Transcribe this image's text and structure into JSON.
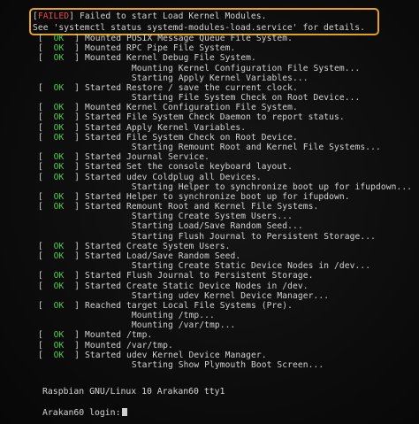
{
  "failed_notice": {
    "tag_open": "[",
    "tag_text": "FAILED",
    "tag_close": "]",
    "line1": "Failed to start Load Kernel Modules.",
    "line2": "See 'systemctl status systemd-modules-load.service' for details."
  },
  "log": [
    {
      "status": "OK",
      "text": "Mounted POSIX Message Queue File System."
    },
    {
      "status": "OK",
      "text": "Mounted RPC Pipe File System."
    },
    {
      "status": "OK",
      "text": "Mounted Kernel Debug File System."
    },
    {
      "status": "",
      "text": "Mounting Kernel Configuration File System..."
    },
    {
      "status": "",
      "text": "Starting Apply Kernel Variables..."
    },
    {
      "status": "OK",
      "text": "Started Restore / save the current clock."
    },
    {
      "status": "",
      "text": "Starting File System Check on Root Device..."
    },
    {
      "status": "OK",
      "text": "Mounted Kernel Configuration File System."
    },
    {
      "status": "OK",
      "text": "Started File System Check Daemon to report status."
    },
    {
      "status": "OK",
      "text": "Started Apply Kernel Variables."
    },
    {
      "status": "OK",
      "text": "Started File System Check on Root Device."
    },
    {
      "status": "",
      "text": "Starting Remount Root and Kernel File Systems..."
    },
    {
      "status": "OK",
      "text": "Started Journal Service."
    },
    {
      "status": "OK",
      "text": "Started Set the console keyboard layout."
    },
    {
      "status": "OK",
      "text": "Started udev Coldplug all Devices."
    },
    {
      "status": "",
      "text": "Starting Helper to synchronize boot up for ifupdown..."
    },
    {
      "status": "OK",
      "text": "Started Helper to synchronize boot up for ifupdown."
    },
    {
      "status": "OK",
      "text": "Started Remount Root and Kernel File Systems."
    },
    {
      "status": "",
      "text": "Starting Create System Users..."
    },
    {
      "status": "",
      "text": "Starting Load/Save Random Seed..."
    },
    {
      "status": "",
      "text": "Starting Flush Journal to Persistent Storage..."
    },
    {
      "status": "OK",
      "text": "Started Create System Users."
    },
    {
      "status": "OK",
      "text": "Started Load/Save Random Seed."
    },
    {
      "status": "",
      "text": "Starting Create Static Device Nodes in /dev..."
    },
    {
      "status": "OK",
      "text": "Started Flush Journal to Persistent Storage."
    },
    {
      "status": "OK",
      "text": "Started Create Static Device Nodes in /dev."
    },
    {
      "status": "",
      "text": "Starting udev Kernel Device Manager..."
    },
    {
      "status": "OK",
      "text": "Reached target Local File Systems (Pre)."
    },
    {
      "status": "",
      "text": "Mounting /tmp..."
    },
    {
      "status": "",
      "text": "Mounting /var/tmp..."
    },
    {
      "status": "OK",
      "text": "Mounted /tmp."
    },
    {
      "status": "OK",
      "text": "Mounted /var/tmp."
    },
    {
      "status": "OK",
      "text": "Started udev Kernel Device Manager."
    },
    {
      "status": "",
      "text": "Starting Show Plymouth Boot Screen..."
    }
  ],
  "banner": "Raspbian GNU/Linux 10 Arakan60 tty1",
  "login_prompt": "Arakan60 login:",
  "colors": {
    "ok": "#4fd04f",
    "failed": "#e84b4b",
    "highlight": "#e2a21c"
  }
}
